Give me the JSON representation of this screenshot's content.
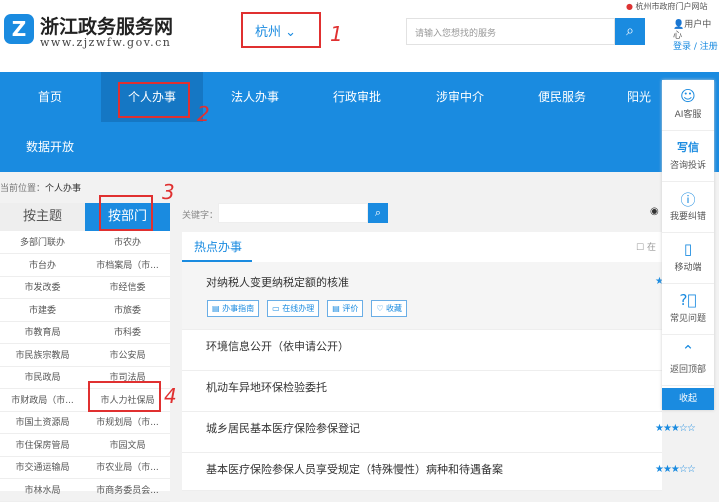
{
  "header": {
    "logo_title": "浙江政务服务网",
    "logo_url": "www.zjzwfw.gov.cn",
    "city": "杭州",
    "search_placeholder": "请输入您想找的服务",
    "gov_site": "杭州市政府门户网站",
    "user_center": "用户中心",
    "login": "登录",
    "register": "注册"
  },
  "nav": [
    "首页",
    "个人办事",
    "法人办事",
    "行政审批",
    "涉审中介",
    "便民服务",
    "阳光",
    "数据开放"
  ],
  "breadcrumb": {
    "label": "当前位置：",
    "current": "个人办事"
  },
  "left": {
    "tabs": [
      "按主题",
      "按部门"
    ],
    "departments": [
      [
        "多部门联办",
        "市农办"
      ],
      [
        "市台办",
        "市档案局（市..."
      ],
      [
        "市发改委",
        "市经信委"
      ],
      [
        "市建委",
        "市旅委"
      ],
      [
        "市教育局",
        "市科委"
      ],
      [
        "市民族宗教局",
        "市公安局"
      ],
      [
        "市民政局",
        "市司法局"
      ],
      [
        "市财政局（市...",
        "市人力社保局"
      ],
      [
        "市国土资源局",
        "市规划局（市..."
      ],
      [
        "市住保房管局",
        "市园文局"
      ],
      [
        "市交通运输局",
        "市农业局（市..."
      ],
      [
        "市林水局",
        "市商务委员会..."
      ]
    ]
  },
  "keyword_label": "关键字：",
  "hot": {
    "tab": "热点办事",
    "online_filter": "在",
    "items": [
      {
        "title": "对纳税人变更纳税定额的核准",
        "stars": "★"
      },
      {
        "title": "环境信息公开（依申请公开）",
        "stars": ""
      },
      {
        "title": "机动车异地环保检验委托",
        "stars": ""
      },
      {
        "title": "城乡居民基本医疗保险参保登记",
        "stars": "★★★☆☆"
      },
      {
        "title": "基本医疗保险参保人员享受规定（特殊慢性）病种和待遇备案",
        "stars": "★★★☆☆"
      }
    ],
    "actions": [
      "办事指南",
      "在线办理",
      "评价",
      "收藏"
    ]
  },
  "float": {
    "items": [
      {
        "icon": "robot-icon",
        "label": "AI客服"
      },
      {
        "icon": "write-letter-icon",
        "label": "咨询投诉",
        "glyph": "写信"
      },
      {
        "icon": "info-icon",
        "label": "我要纠错"
      },
      {
        "icon": "mobile-icon",
        "label": "移动端"
      },
      {
        "icon": "question-icon",
        "label": "常见问题"
      },
      {
        "icon": "back-to-top-icon",
        "label": "返回顶部"
      }
    ],
    "collapse": "收起"
  },
  "annotations": [
    "1",
    "2",
    "3",
    "4"
  ],
  "colors": {
    "primary": "#1a8be0",
    "annotation": "#e03030"
  }
}
